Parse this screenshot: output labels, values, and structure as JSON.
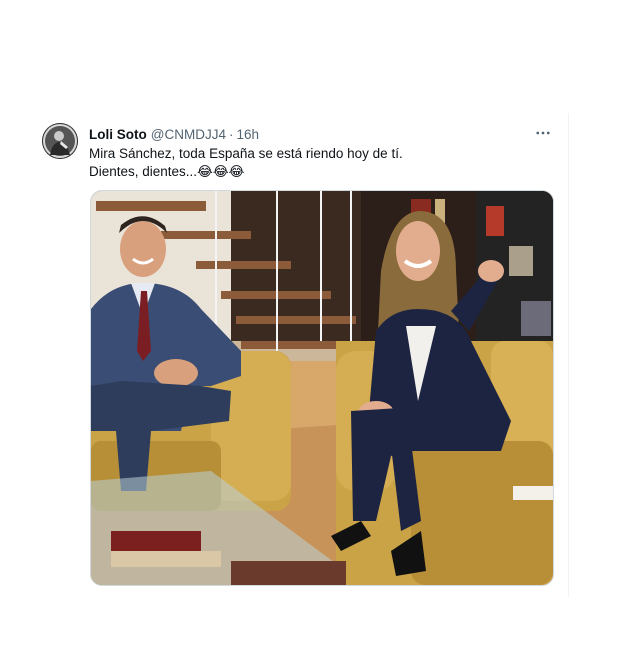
{
  "tweet": {
    "display_name": "Loli Soto",
    "handle": "@CNMDJJ4",
    "separator": "·",
    "time": "16h",
    "text_line1": "Mira Sánchez, toda España se está riendo hoy de tí.",
    "text_line2": "Dientes, dientes...😂😂😂",
    "more_icon": "more-horizontal-icon",
    "avatar_icon": "profile-avatar",
    "media_icon": "tweet-photo"
  },
  "colors": {
    "text_primary": "#0f1419",
    "text_secondary": "#536471",
    "border": "#cfd9de"
  }
}
